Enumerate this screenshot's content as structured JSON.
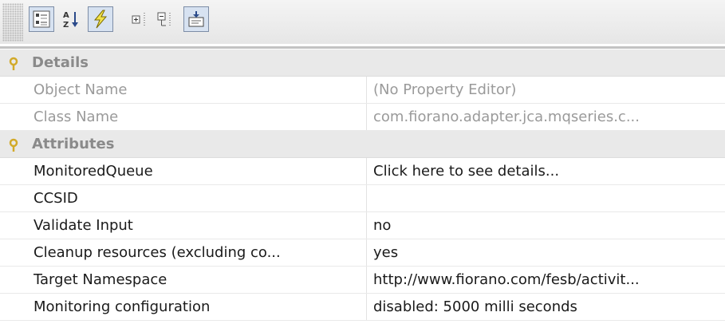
{
  "toolbar": {
    "buttons": [
      {
        "icon": "categorized-view-icon",
        "active": true
      },
      {
        "icon": "sort-alphabetical-icon",
        "active": false
      },
      {
        "icon": "show-events-icon",
        "active": true
      },
      {
        "icon": "expand-all-icon",
        "active": false
      },
      {
        "icon": "collapse-all-icon",
        "active": false
      },
      {
        "icon": "show-description-icon",
        "active": true
      }
    ]
  },
  "sheet": {
    "details": {
      "label": "Details",
      "rows": [
        {
          "name": "Object Name",
          "value": "(No Property Editor)"
        },
        {
          "name": "Class Name",
          "value": "com.fiorano.adapter.jca.mqseries.c..."
        }
      ]
    },
    "attributes": {
      "label": "Attributes",
      "rows": [
        {
          "name": "MonitoredQueue",
          "value": "Click here to see details..."
        },
        {
          "name": "CCSID",
          "value": ""
        },
        {
          "name": "Validate Input",
          "value": "no"
        },
        {
          "name": "Cleanup resources (excluding co...",
          "value": "yes"
        },
        {
          "name": "Target Namespace",
          "value": "http://www.fiorano.com/fesb/activit..."
        },
        {
          "name": "Monitoring configuration",
          "value": "disabled: 5000 milli seconds"
        }
      ]
    }
  },
  "colors": {
    "accent": "#d2aa2a",
    "category_bg": "#e9e9e9",
    "readonly_text": "#9a9a9a"
  }
}
